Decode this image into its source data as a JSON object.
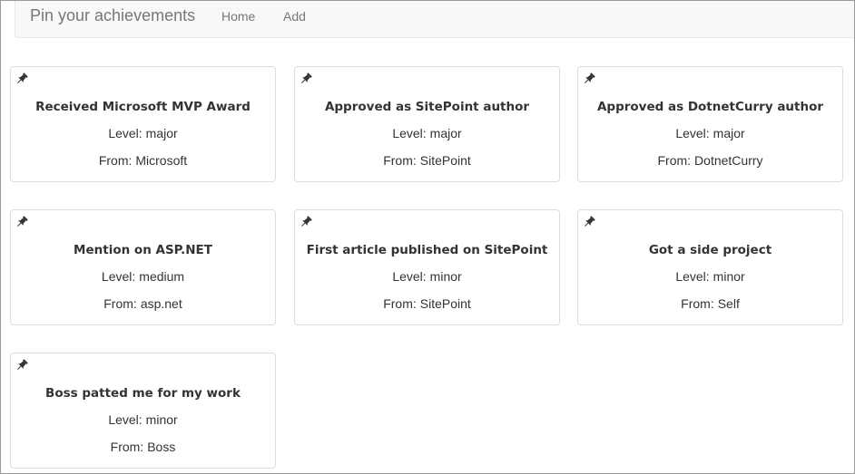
{
  "navbar": {
    "brand": "Pin your achievements",
    "links": {
      "home": "Home",
      "add": "Add"
    }
  },
  "labels": {
    "level": "Level:",
    "from": "From:"
  },
  "icons": {
    "pin": "pushpin-icon"
  },
  "achievements": [
    {
      "title": "Received Microsoft MVP Award",
      "level": "major",
      "from": "Microsoft"
    },
    {
      "title": "Approved as SitePoint author",
      "level": "major",
      "from": "SitePoint"
    },
    {
      "title": "Approved as DotnetCurry author",
      "level": "major",
      "from": "DotnetCurry"
    },
    {
      "title": "Mention on ASP.NET",
      "level": "medium",
      "from": "asp.net"
    },
    {
      "title": "First article published on SitePoint",
      "level": "minor",
      "from": "SitePoint"
    },
    {
      "title": "Got a side project",
      "level": "minor",
      "from": "Self"
    },
    {
      "title": "Boss patted me for my work",
      "level": "minor",
      "from": "Boss"
    }
  ]
}
